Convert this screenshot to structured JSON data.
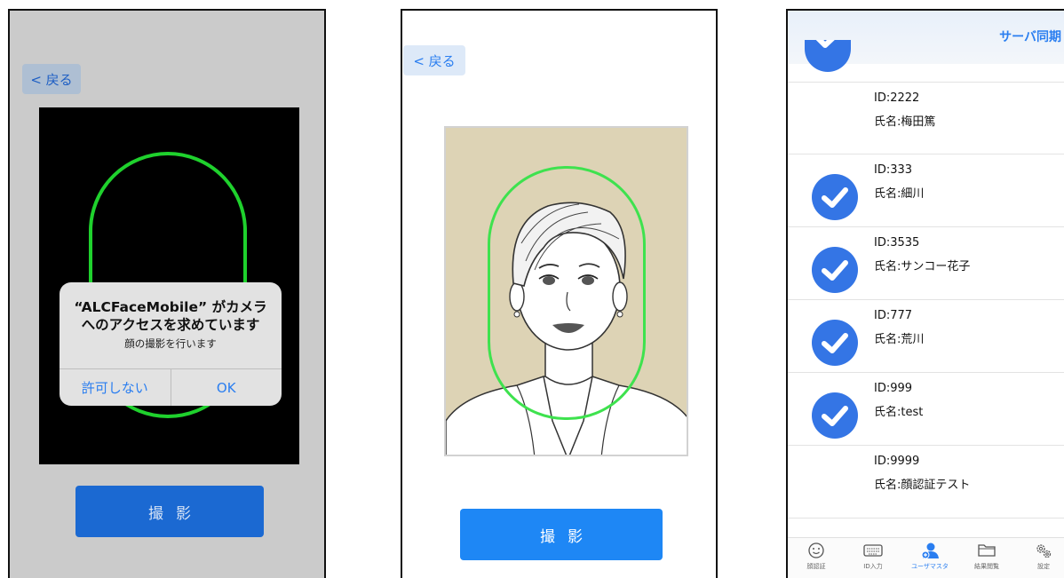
{
  "screen1": {
    "back_label": "< 戻る",
    "alert": {
      "title_line1": "“ALCFaceMobile” がカメラ",
      "title_line2": "へのアクセスを求めています",
      "message": "顔の撮影を行います",
      "deny_label": "許可しない",
      "ok_label": "OK"
    },
    "shoot_label": "撮影"
  },
  "screen2": {
    "back_label": "< 戻る",
    "shoot_label": "撮影"
  },
  "screen3": {
    "sync_label": "サーバ同期",
    "users": [
      {
        "id": "ID:2222",
        "name": "氏名:梅田篤",
        "checked": false
      },
      {
        "id": "ID:333",
        "name": "氏名:細川",
        "checked": true
      },
      {
        "id": "ID:3535",
        "name": "氏名:サンコー花子",
        "checked": true
      },
      {
        "id": "ID:777",
        "name": "氏名:荒川",
        "checked": true
      },
      {
        "id": "ID:999",
        "name": "氏名:test",
        "checked": true
      },
      {
        "id": "ID:9999",
        "name": "氏名:顔認証テスト",
        "checked": false
      }
    ],
    "tabs": [
      {
        "label": "顔認証",
        "icon": "smiley-icon",
        "active": false
      },
      {
        "label": "ID入力",
        "icon": "keyboard-icon",
        "active": false
      },
      {
        "label": "ユーザマスタ",
        "icon": "add-user-icon",
        "active": true
      },
      {
        "label": "結果閲覧",
        "icon": "folder-icon",
        "active": false
      },
      {
        "label": "設定",
        "icon": "gear-icon",
        "active": false
      }
    ],
    "accent_color": "#3475e5"
  }
}
